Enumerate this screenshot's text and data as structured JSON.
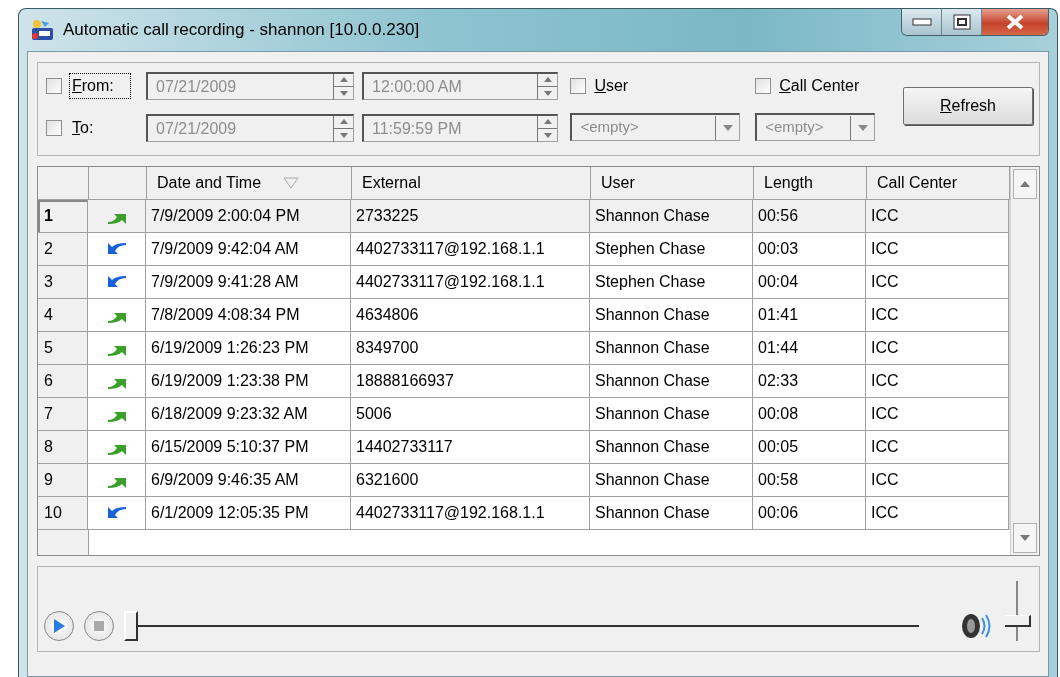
{
  "window": {
    "title": "Automatic call recording - shannon [10.0.0.230]"
  },
  "filters": {
    "from": {
      "label": "From:",
      "checked": false,
      "date": "07/21/2009",
      "time": "12:00:00 AM"
    },
    "to": {
      "label": "To:",
      "checked": false,
      "date": "07/21/2009",
      "time": "11:59:59 PM"
    },
    "user": {
      "label": "User",
      "checked": false,
      "value": "<empty>"
    },
    "call_center": {
      "label": "Call Center",
      "checked": false,
      "value": "<empty>"
    },
    "refresh_button": "Refresh"
  },
  "table": {
    "columns": [
      "Date and Time",
      "External",
      "User",
      "Length",
      "Call Center"
    ],
    "rows": [
      {
        "number": "1",
        "kind": "outgoing",
        "selected": true,
        "cells": [
          "7/9/2009 2:00:04 PM",
          "2733225",
          "Shannon Chase",
          "00:56",
          "ICC"
        ]
      },
      {
        "number": "2",
        "kind": "incoming",
        "selected": false,
        "cells": [
          "7/9/2009 9:42:04 AM",
          "4402733117@192.168.1.1",
          "Stephen Chase",
          "00:03",
          "ICC"
        ]
      },
      {
        "number": "3",
        "kind": "incoming",
        "selected": false,
        "cells": [
          "7/9/2009 9:41:28 AM",
          "4402733117@192.168.1.1",
          "Stephen Chase",
          "00:04",
          "ICC"
        ]
      },
      {
        "number": "4",
        "kind": "outgoing",
        "selected": false,
        "cells": [
          "7/8/2009 4:08:34 PM",
          "4634806",
          "Shannon Chase",
          "01:41",
          "ICC"
        ]
      },
      {
        "number": "5",
        "kind": "outgoing",
        "selected": false,
        "cells": [
          "6/19/2009 1:26:23 PM",
          "8349700",
          "Shannon Chase",
          "01:44",
          "ICC"
        ]
      },
      {
        "number": "6",
        "kind": "outgoing",
        "selected": false,
        "cells": [
          "6/19/2009 1:23:38 PM",
          "18888166937",
          "Shannon Chase",
          "02:33",
          "ICC"
        ]
      },
      {
        "number": "7",
        "kind": "outgoing",
        "selected": false,
        "cells": [
          "6/18/2009 9:23:32 AM",
          "5006",
          "Shannon Chase",
          "00:08",
          "ICC"
        ]
      },
      {
        "number": "8",
        "kind": "outgoing",
        "selected": false,
        "cells": [
          "6/15/2009 5:10:37 PM",
          "14402733117",
          "Shannon Chase",
          "00:05",
          "ICC"
        ]
      },
      {
        "number": "9",
        "kind": "outgoing",
        "selected": false,
        "cells": [
          "6/9/2009 9:46:35 AM",
          "6321600",
          "Shannon Chase",
          "00:58",
          "ICC"
        ]
      },
      {
        "number": "10",
        "kind": "incoming",
        "selected": false,
        "cells": [
          "6/1/2009 12:05:35 PM",
          "4402733117@192.168.1.1",
          "Shannon Chase",
          "00:06",
          "ICC"
        ]
      }
    ]
  },
  "player": {
    "position": {
      "level": 0
    },
    "volume": {
      "level": 0.3
    }
  }
}
